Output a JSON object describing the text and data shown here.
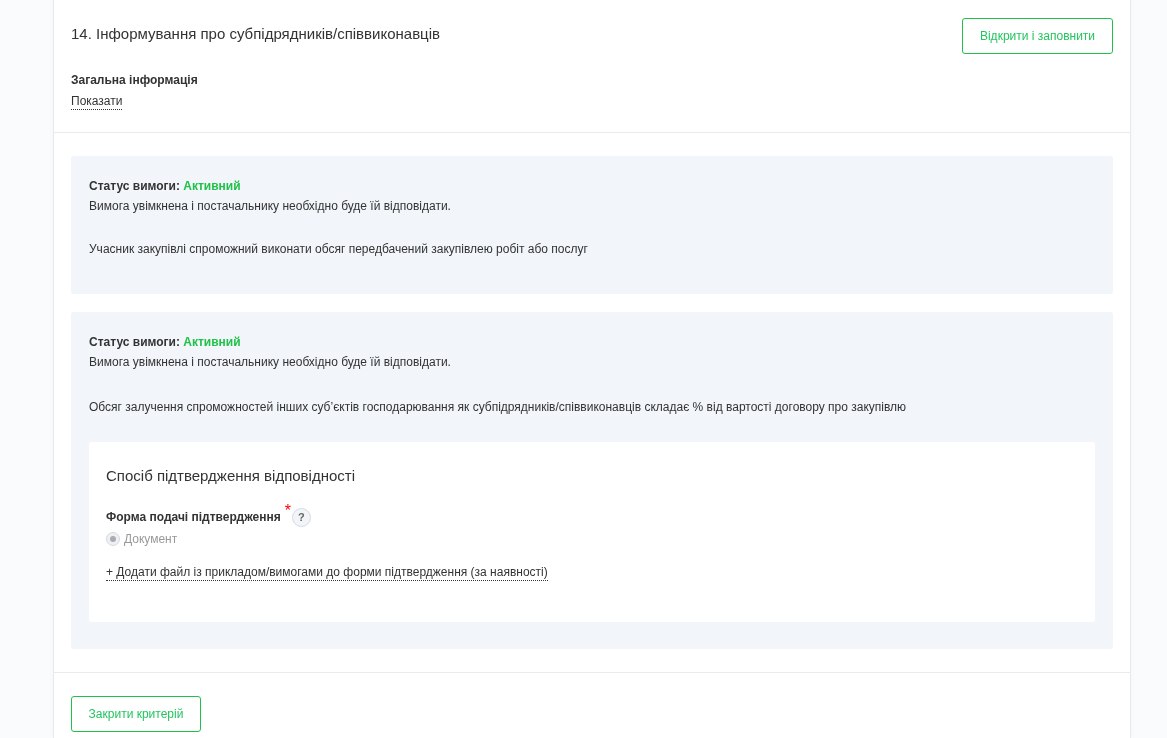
{
  "criterion": {
    "title": "14. Інформування про субпідрядників/співвиконавців",
    "open_button": "Відкрити і заповнити",
    "general_info": {
      "heading": "Загальна інформація",
      "toggle_link": "Показати"
    }
  },
  "requirements": [
    {
      "status_label": "Статус вимоги:",
      "status_value": "Активний",
      "active": true,
      "note": "Вимога увімкнена і постачальнику необхідно буде їй відповідати.",
      "description": "Учасник закупівлі спроможний виконати обсяг передбачений закупівлею робіт або послуг"
    },
    {
      "status_label": "Статус вимоги:",
      "status_value": "Активний",
      "active": true,
      "note": "Вимога увімкнена і постачальнику необхідно буде їй відповідати.",
      "description": "Обсяг залучення спроможностей інших суб’єктів господарювання як субпідрядників/співвиконавців складає % від вартості договору про закупівлю",
      "confirmation": {
        "heading": "Спосіб підтвердження відповідності",
        "field_label": "Форма подачі підтвердження",
        "required_mark": "*",
        "help": "?",
        "options": [
          {
            "label": "Документ",
            "selected": true,
            "disabled": true
          }
        ],
        "add_file_link": "+ Додати файл із прикладом/вимогами до форми підтвердження (за наявності)"
      }
    }
  ],
  "close_button": "Закрити критерій"
}
